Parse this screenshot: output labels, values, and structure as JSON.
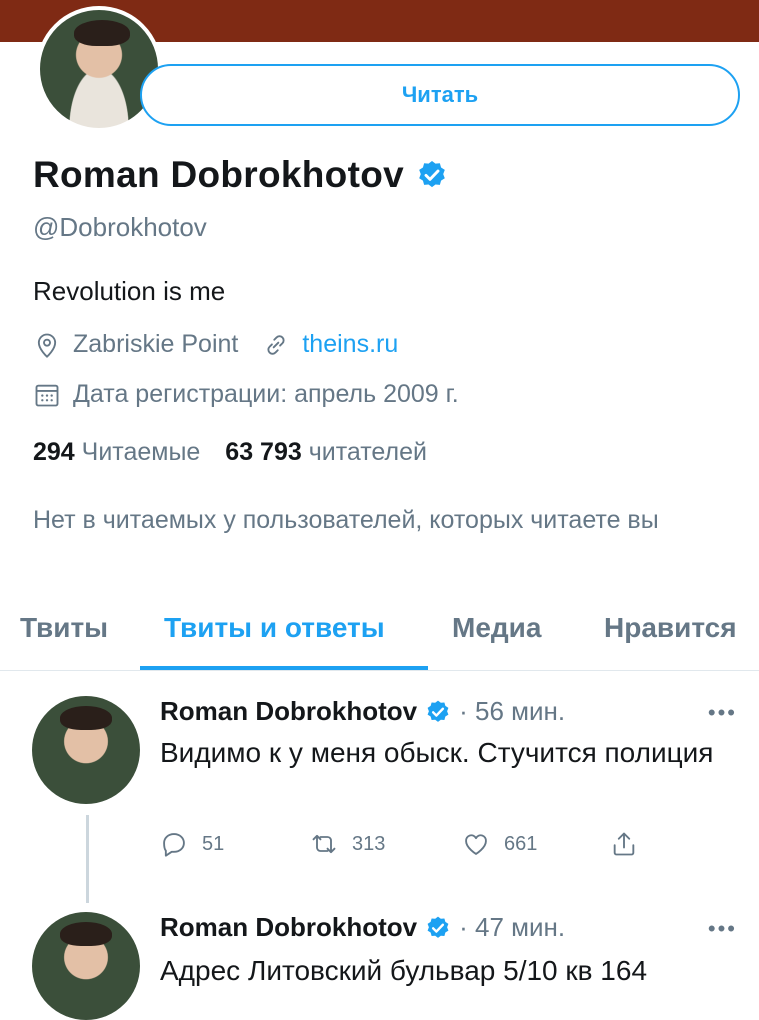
{
  "header": {
    "banner_color": "#7f2a14"
  },
  "profile": {
    "follow_label": "Читать",
    "name": "Roman Dobrokhotov",
    "handle": "@Dobrokhotov",
    "bio": "Revolution is me",
    "location": "Zabriskie Point",
    "website": "theins.ru",
    "registered": "Дата регистрации: апрель 2009 г.",
    "following_count": "294",
    "following_label": "Читаемые",
    "followers_count": "63 793",
    "followers_label": "читателей",
    "notice": "Нет в читаемых у пользователей, которых читаете вы"
  },
  "tabs": [
    {
      "label": "Твиты"
    },
    {
      "label": "Твиты и ответы"
    },
    {
      "label": "Медиа"
    },
    {
      "label": "Нравится"
    }
  ],
  "tweets": [
    {
      "author": "Roman Dobrokhotov",
      "time": "· 56 мин.",
      "text": "Видимо к у меня обыск. Стучится полиция",
      "replies": "51",
      "retweets": "313",
      "likes": "661"
    },
    {
      "author": "Roman Dobrokhotov",
      "time": "· 47 мин.",
      "text": "Адрес Литовский бульвар 5/10 кв 164"
    }
  ],
  "colors": {
    "accent": "#1da1f2",
    "muted": "#657786",
    "text": "#14171a"
  },
  "icons": [
    "verified-badge-icon",
    "location-icon",
    "link-icon",
    "calendar-icon",
    "reply-icon",
    "retweet-icon",
    "like-icon",
    "share-icon",
    "more-icon"
  ]
}
